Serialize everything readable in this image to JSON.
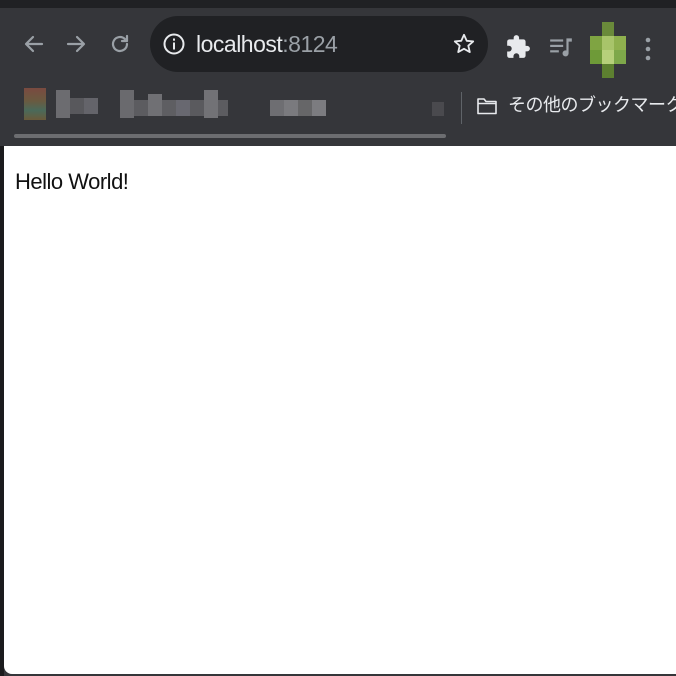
{
  "browser": {
    "address_bar": {
      "host": "localhost",
      "port": ":8124"
    },
    "icons": {
      "back": "arrow-left-icon",
      "forward": "arrow-right-icon",
      "reload": "reload-icon",
      "info": "info-icon",
      "bookmark_star": "star-icon",
      "extensions": "puzzle-icon",
      "media": "media-queue-icon",
      "menu": "three-dots-vertical-icon",
      "folder": "folder-icon"
    },
    "bookmarks_bar": {
      "other_bookmarks_label": "その他のブックマーク"
    },
    "colors": {
      "toolbar_bg": "#35363a",
      "omnibox_bg": "#202124",
      "text_primary": "#e8eaed",
      "text_secondary": "#9aa0a6",
      "page_bg": "#ffffff"
    }
  },
  "page": {
    "body_text": "Hello World!"
  }
}
